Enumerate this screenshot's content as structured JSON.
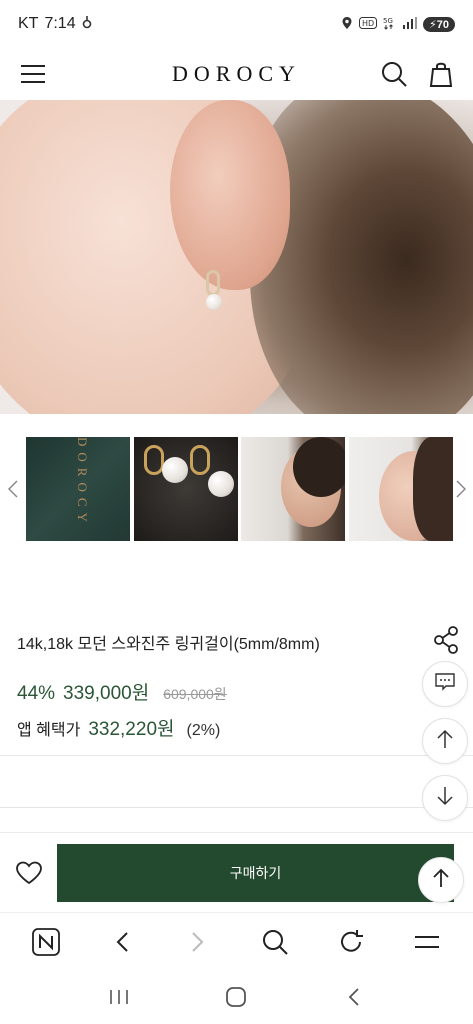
{
  "status_bar": {
    "carrier": "KT",
    "time": "7:14",
    "battery": "70"
  },
  "header": {
    "logo": "DOROCY"
  },
  "product": {
    "title": "14k,18k 모던 스와진주 링귀걸이(5mm/8mm)",
    "discount": "44%",
    "sale_price": "339,000원",
    "original_price": "609,000원",
    "app_label": "앱 혜택가",
    "app_price": "332,220원",
    "app_percent": "(2%)"
  },
  "buy_bar": {
    "buy_label": "구매하기"
  },
  "icons": {
    "menu": "menu-icon",
    "search": "search-icon",
    "bag": "shopping-bag-icon",
    "share": "share-icon",
    "chat": "chat-icon",
    "up": "arrow-up-icon",
    "down": "arrow-down-icon",
    "wish": "heart-icon"
  },
  "colors": {
    "accent": "#234a2e",
    "price": "#2b5636"
  }
}
